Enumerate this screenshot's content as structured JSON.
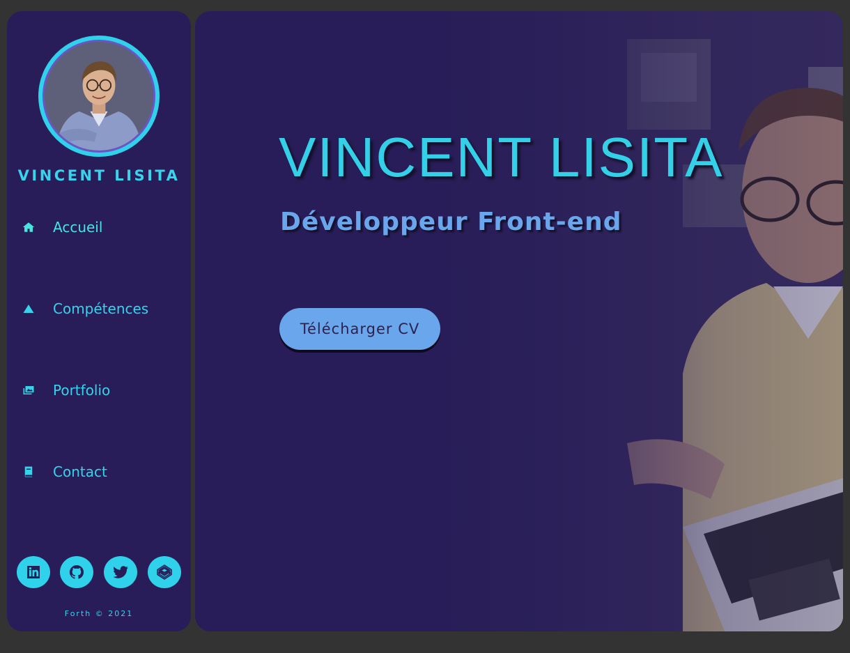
{
  "sidebar": {
    "name": "VINCENT LISITA",
    "nav": [
      {
        "label": "Accueil",
        "icon": "home-icon"
      },
      {
        "label": "Compétences",
        "icon": "mountain-icon"
      },
      {
        "label": "Portfolio",
        "icon": "images-icon"
      },
      {
        "label": "Contact",
        "icon": "book-icon"
      }
    ],
    "socials": [
      "linkedin-icon",
      "github-icon",
      "twitter-icon",
      "codepen-icon"
    ],
    "footer": "Forth © 2021"
  },
  "hero": {
    "title": "VINCENT LISITA",
    "subtitle": "Développeur Front-end",
    "cv_button": "Télécharger CV"
  },
  "colors": {
    "panel": "#281d58",
    "page_bg": "#333333",
    "accent_cyan": "#33d0e8",
    "accent_blue": "#6aa6ec",
    "active_nav": "#45e6e0"
  }
}
